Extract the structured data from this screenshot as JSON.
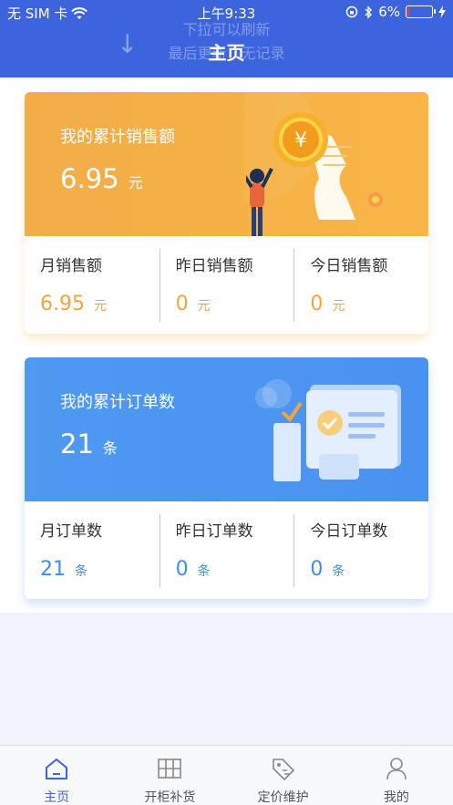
{
  "status_bar": {
    "carrier": "无 SIM 卡",
    "time": "上午9:33",
    "battery": "6%",
    "battery_level": 0.06
  },
  "header": {
    "pull_hint": "下拉可以刷新",
    "last_update": "最后更新：无记录",
    "title": "主页"
  },
  "sales": {
    "total_label": "我的累计销售额",
    "total_value": "6.95",
    "total_unit": "元",
    "stats": [
      {
        "label": "月销售额",
        "value": "6.95",
        "unit": "元"
      },
      {
        "label": "昨日销售额",
        "value": "0",
        "unit": "元"
      },
      {
        "label": "今日销售额",
        "value": "0",
        "unit": "元"
      }
    ]
  },
  "orders": {
    "total_label": "我的累计订单数",
    "total_value": "21",
    "total_unit": "条",
    "stats": [
      {
        "label": "月订单数",
        "value": "21",
        "unit": "条"
      },
      {
        "label": "昨日订单数",
        "value": "0",
        "unit": "条"
      },
      {
        "label": "今日订单数",
        "value": "0",
        "unit": "条"
      }
    ]
  },
  "tabbar": {
    "items": [
      {
        "label": "主页",
        "icon": "home-icon"
      },
      {
        "label": "开柜补货",
        "icon": "cabinet-icon"
      },
      {
        "label": "定价维护",
        "icon": "price-tag-icon"
      },
      {
        "label": "我的",
        "icon": "user-icon"
      }
    ],
    "active_color": "#3d64dd"
  },
  "colors": {
    "header": "#3d64dd",
    "sales_accent": "#f2a53c",
    "orders_accent": "#3c8ef0"
  }
}
